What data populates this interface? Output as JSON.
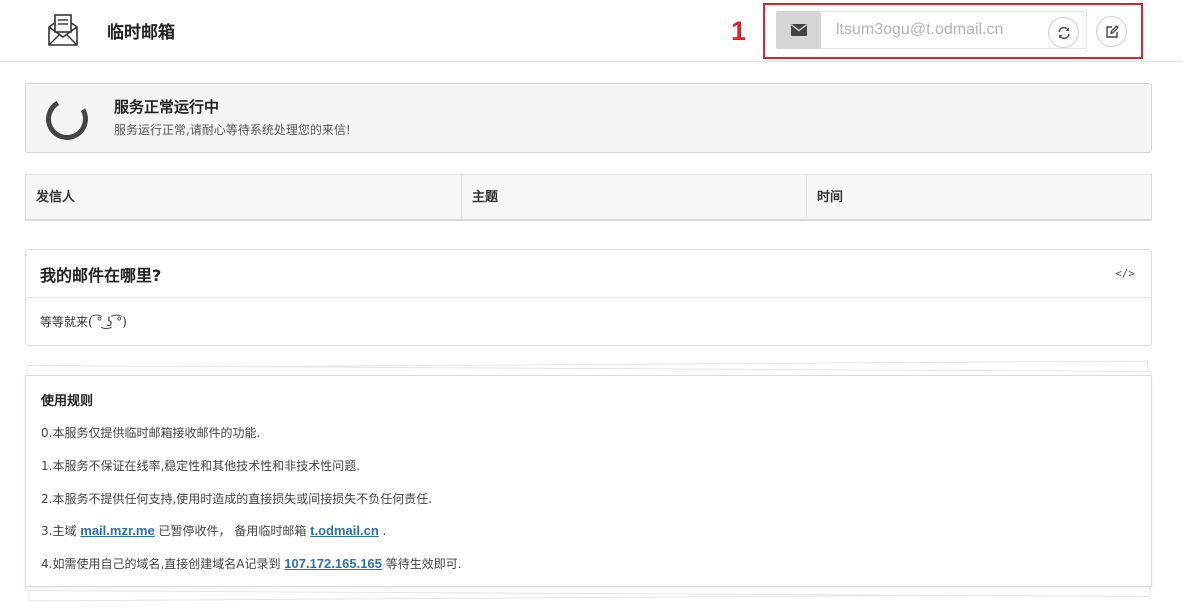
{
  "header": {
    "brand": "临时邮箱",
    "annotation_number": "1",
    "email_value": "ltsum3ogu@t.odmail.cn",
    "icons": {
      "logo": "envelope-letter-icon",
      "mail": "envelope-icon",
      "refresh": "refresh-icon",
      "edit": "edit-icon"
    }
  },
  "status": {
    "title": "服务正常运行中",
    "description": "服务运行正常,请耐心等待系统处理您的来信!"
  },
  "table": {
    "columns": [
      "发信人",
      "主题",
      "时间"
    ]
  },
  "faq": {
    "title": "我的邮件在哪里?",
    "code_icon": "</>",
    "body": "等等就来( ͡° ͜ʖ ͡°)"
  },
  "rules": {
    "title": "使用规则",
    "items": [
      "0.本服务仅提供临时邮箱接收邮件的功能.",
      "1.本服务不保证在线率,稳定性和其他技术性和非技术性问题.",
      "2.本服务不提供任何支持,使用时造成的直接损失或间接损失不负任何责任."
    ],
    "item3": {
      "prefix": "3.主域 ",
      "link1": "mail.mzr.me",
      "middle": " 已暂停收件， 备用临时邮箱 ",
      "link2": "t.odmail.cn",
      "suffix": " ."
    },
    "item4": {
      "prefix": "4.如需使用自己的域名,直接创建域名A记录到 ",
      "link": "107.172.165.165",
      "suffix": " 等待生效即可."
    }
  },
  "colors": {
    "accent_red": "#d9232d",
    "link_blue": "#2a6fb5"
  }
}
